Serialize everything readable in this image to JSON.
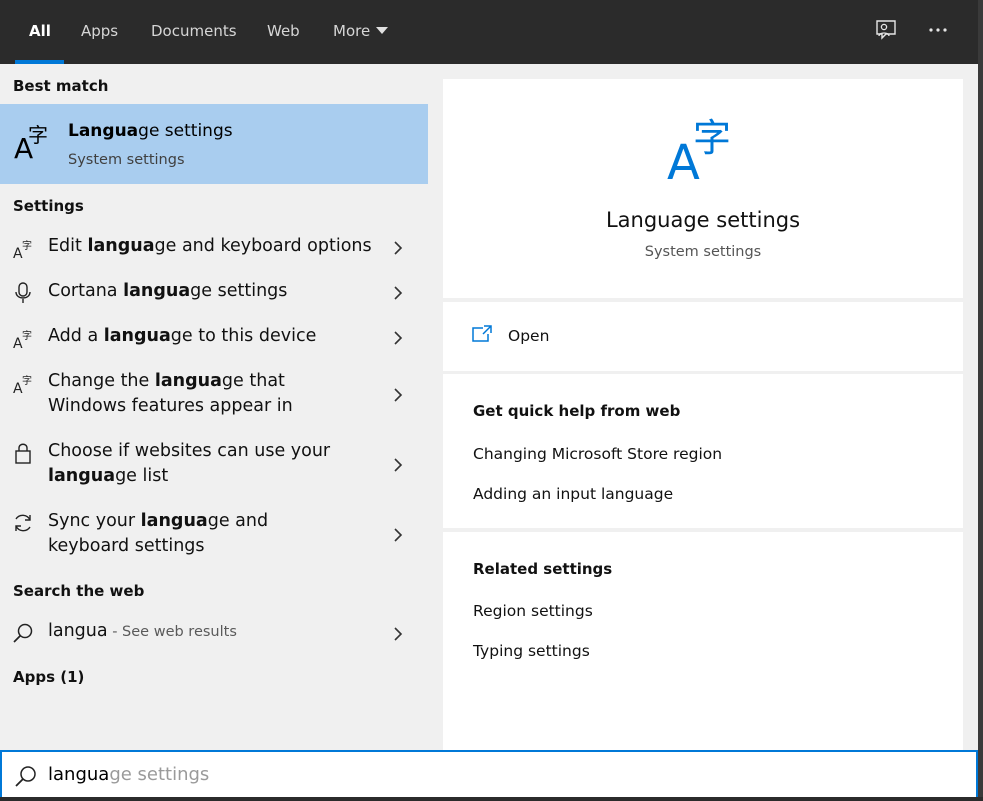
{
  "tabs": [
    {
      "label": "All",
      "active": true
    },
    {
      "label": "Apps"
    },
    {
      "label": "Documents"
    },
    {
      "label": "Web"
    },
    {
      "label": "More"
    }
  ],
  "top_icons": [
    "feedback-icon",
    "more-options-icon"
  ],
  "left": {
    "best_match_heading": "Best match",
    "best_match": {
      "title_bold": "Langua",
      "title_rest": "ge settings",
      "subtitle": "System settings",
      "icon": "language-icon"
    },
    "settings_heading": "Settings",
    "settings_items": [
      {
        "pre": "Edit ",
        "bold": "langua",
        "post": "ge and keyboard options",
        "icon": "language-icon"
      },
      {
        "pre": "Cortana ",
        "bold": "langua",
        "post": "ge settings",
        "icon": "microphone-icon"
      },
      {
        "pre": "Add a ",
        "bold": "langua",
        "post": "ge to this device",
        "icon": "language-icon"
      },
      {
        "pre": "Change the ",
        "bold": "langua",
        "post": "ge that Windows features appear in",
        "icon": "language-icon"
      },
      {
        "pre": "Choose if websites can use your ",
        "bold": "langua",
        "post": "ge list",
        "icon": "lock-icon"
      },
      {
        "pre": "Sync your ",
        "bold": "langua",
        "post": "ge and keyboard settings",
        "icon": "sync-icon"
      }
    ],
    "web_heading": "Search the web",
    "web_item": {
      "query": "langua",
      "suffix": " - See web results",
      "icon": "search-icon"
    },
    "apps_heading": "Apps (1)"
  },
  "preview": {
    "title": "Language settings",
    "subtitle": "System settings",
    "open_label": "Open",
    "quick_help_heading": "Get quick help from web",
    "quick_help_links": [
      "Changing Microsoft Store region",
      "Adding an input language"
    ],
    "related_heading": "Related settings",
    "related_links": [
      "Region settings",
      "Typing settings"
    ]
  },
  "search": {
    "typed": "langua",
    "completion": "ge settings"
  },
  "colors": {
    "accent": "#0078d7",
    "selected_bg": "#a9cdef",
    "topbar_bg": "#2b2b2b"
  }
}
